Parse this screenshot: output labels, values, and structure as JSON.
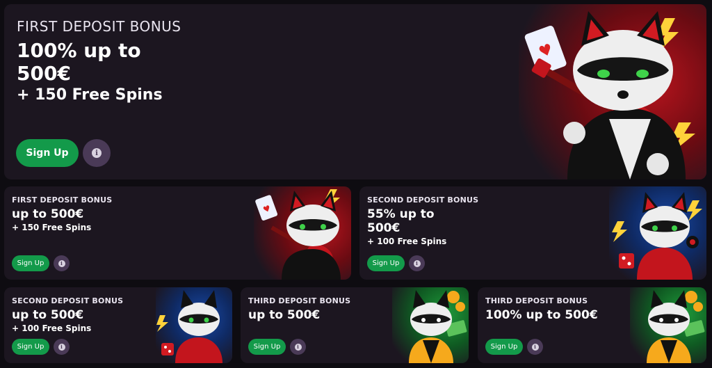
{
  "hero": {
    "eyebrow": "FIRST DEPOSIT BONUS",
    "headline": "100% up to 500€",
    "subline": "+ 150 Free Spins",
    "signup_label": "Sign Up",
    "info_label": "i"
  },
  "cards": [
    {
      "eyebrow": "FIRST DEPOSIT BONUS",
      "headline": "up to 500€",
      "subline": "+ 150 Free Spins",
      "signup_label": "Sign Up",
      "info_label": "i"
    },
    {
      "eyebrow": "SECOND DEPOSIT BONUS",
      "headline": "55% up to 500€",
      "subline": "+ 100 Free Spins",
      "signup_label": "Sign Up",
      "info_label": "i"
    },
    {
      "eyebrow": "SECOND DEPOSIT BONUS",
      "headline": "up to 500€",
      "subline": "+ 100 Free Spins",
      "signup_label": "Sign Up",
      "info_label": "i"
    },
    {
      "eyebrow": "THIRD DEPOSIT BONUS",
      "headline": "up to 500€",
      "subline": "",
      "signup_label": "Sign Up",
      "info_label": "i"
    },
    {
      "eyebrow": "THIRD DEPOSIT BONUS",
      "headline": "100% up to 500€",
      "subline": "",
      "signup_label": "Sign Up",
      "info_label": "i"
    }
  ],
  "colors": {
    "background": "#0e0c11",
    "card": "#1c1620",
    "signup_green": "#139a4a",
    "info_purple": "#4a3a57",
    "art_red": "#b8141d",
    "art_blue": "#1a4aa8",
    "art_green": "#1f9a3a"
  },
  "icons": {
    "info": "info-icon",
    "mascot": "raccoon-mascot-illustration"
  }
}
